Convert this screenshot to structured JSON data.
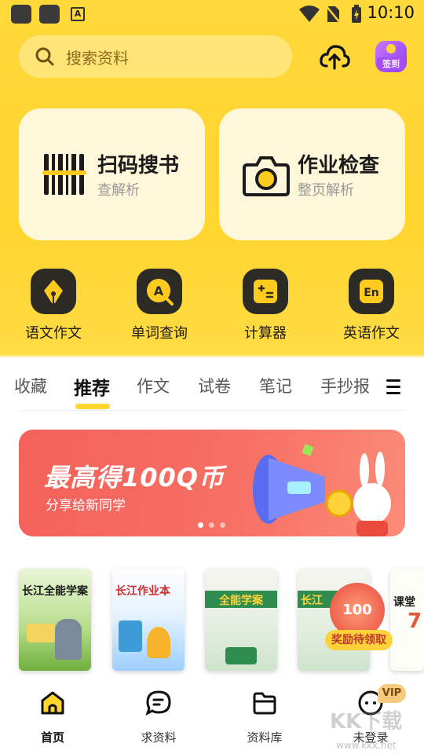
{
  "status_bar": {
    "time": "10:10",
    "badge_letter": "A"
  },
  "search": {
    "placeholder": "搜索资料"
  },
  "checkin": {
    "label": "签到"
  },
  "cards": [
    {
      "title": "扫码搜书",
      "subtitle": "查解析",
      "icon": "barcode-icon"
    },
    {
      "title": "作业检查",
      "subtitle": "整页解析",
      "icon": "camera-icon"
    }
  ],
  "tools": [
    {
      "label": "语文作文",
      "icon": "pen-icon"
    },
    {
      "label": "单词查询",
      "icon": "word-search-icon"
    },
    {
      "label": "计算器",
      "icon": "calculator-icon"
    },
    {
      "label": "英语作文",
      "icon": "english-icon"
    }
  ],
  "tabs": [
    "收藏",
    "推荐",
    "作文",
    "试卷",
    "笔记",
    "手抄报"
  ],
  "active_tab": "推荐",
  "banner": {
    "title": "最高得100Q币",
    "subtitle": "分享给新同学",
    "pages": 3,
    "current_page": 1
  },
  "books": [
    {
      "title": "长江全能学案",
      "color": "#7dbd4a"
    },
    {
      "title": "长江作业本",
      "color": "#3f9bd8"
    },
    {
      "title": "全能学案",
      "color": "#2d8c4e"
    },
    {
      "title": "长江",
      "color": "#2d8c4e"
    },
    {
      "title": "课堂",
      "color": "#e35a3a"
    }
  ],
  "reward": {
    "amount": "100",
    "label": "奖励待领取"
  },
  "bottom_nav": [
    {
      "label": "首页",
      "icon": "home-icon"
    },
    {
      "label": "求资料",
      "icon": "chat-icon"
    },
    {
      "label": "资料库",
      "icon": "folder-icon"
    },
    {
      "label": "未登录",
      "icon": "profile-icon"
    }
  ],
  "vip_badge": "VIP",
  "watermark": {
    "main": "KK下载",
    "sub": "www.kkx.net"
  },
  "colors": {
    "brand_yellow": "#FFD52E",
    "card_bg": "#FFF7DA",
    "banner_red": "#F4615A"
  }
}
